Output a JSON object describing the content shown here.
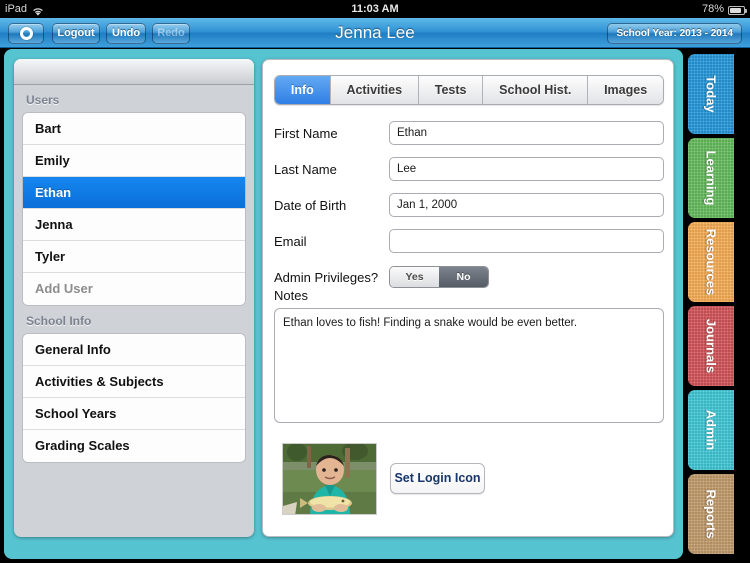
{
  "statusbar": {
    "device": "iPad",
    "wifi_icon": "wifi-icon",
    "time": "11:03 AM",
    "battery_pct": "78%",
    "battery_icon": "battery-icon"
  },
  "toolbar": {
    "gear_icon": "gear-icon",
    "logout_label": "Logout",
    "undo_label": "Undo",
    "redo_label": "Redo",
    "title": "Jenna Lee",
    "school_year_label": "School Year: 2013 - 2014",
    "accent_color": "#2f91d4"
  },
  "sidebar": {
    "users_header": "Users",
    "users": [
      {
        "label": "Bart",
        "selected": false
      },
      {
        "label": "Emily",
        "selected": false
      },
      {
        "label": "Ethan",
        "selected": true
      },
      {
        "label": "Jenna",
        "selected": false
      },
      {
        "label": "Tyler",
        "selected": false
      },
      {
        "label": "Add User",
        "selected": false,
        "muted": true
      }
    ],
    "school_info_header": "School Info",
    "school_info": [
      {
        "label": "General Info"
      },
      {
        "label": "Activities & Subjects"
      },
      {
        "label": "School Years"
      },
      {
        "label": "Grading Scales"
      }
    ],
    "selected_color": "#0b6fd8"
  },
  "main": {
    "tabs": [
      {
        "label": "Info",
        "active": true
      },
      {
        "label": "Activities",
        "active": false
      },
      {
        "label": "Tests",
        "active": false
      },
      {
        "label": "School Hist.",
        "active": false
      },
      {
        "label": "Images",
        "active": false
      }
    ],
    "fields": {
      "first_name_label": "First Name",
      "first_name_value": "Ethan",
      "last_name_label": "Last Name",
      "last_name_value": "Lee",
      "dob_label": "Date of Birth",
      "dob_value": "Jan 1, 2000",
      "email_label": "Email",
      "email_value": "",
      "email_placeholder": "",
      "admin_label": "Admin Privileges?",
      "admin_yes": "Yes",
      "admin_no": "No",
      "admin_selected": "No"
    },
    "notes_label": "Notes",
    "notes_value": "Ethan loves to fish! Finding a snake would be even better.",
    "photo_name": "user-photo",
    "set_login_icon_label": "Set Login Icon"
  },
  "vertical_tabs": [
    {
      "label": "Today",
      "color": "#2497d8"
    },
    {
      "label": "Learning",
      "color": "#64bb5c"
    },
    {
      "label": "Resources",
      "color": "#f5ab52"
    },
    {
      "label": "Journals",
      "color": "#d15358"
    },
    {
      "label": "Admin",
      "color": "#3ec6d4"
    },
    {
      "label": "Reports",
      "color": "#c19a6b"
    }
  ]
}
